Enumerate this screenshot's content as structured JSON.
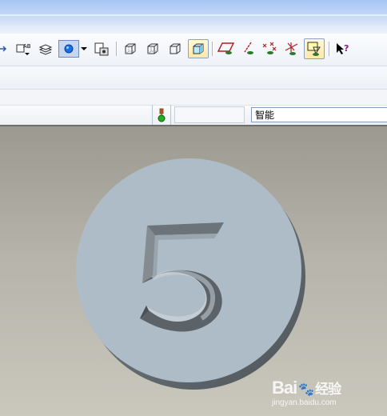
{
  "toolbar": {
    "buttons": [
      {
        "name": "named-view-icon"
      },
      {
        "name": "annotation-display-icon"
      },
      {
        "name": "layer-icon"
      },
      {
        "name": "display-style-icon"
      },
      {
        "name": "display-style-dropdown-icon"
      },
      {
        "name": "saved-view-icon"
      },
      {
        "name": "wireframe-icon"
      },
      {
        "name": "hidden-line-icon"
      },
      {
        "name": "no-hidden-icon"
      },
      {
        "name": "shading-icon"
      },
      {
        "name": "datum-plane-display-icon"
      },
      {
        "name": "datum-axis-display-icon"
      },
      {
        "name": "datum-point-display-icon"
      },
      {
        "name": "coordinate-system-display-icon"
      },
      {
        "name": "spin-center-icon"
      },
      {
        "name": "context-help-icon"
      }
    ]
  },
  "statusbar": {
    "filter_value": "智能"
  },
  "watermark": {
    "logo_text": "Bai",
    "logo_suffix": "经验",
    "site": "jingyan.baidu.com"
  },
  "model": {
    "digit": "5",
    "face_color": "#aebcc7",
    "side_color": "#5b6268"
  }
}
